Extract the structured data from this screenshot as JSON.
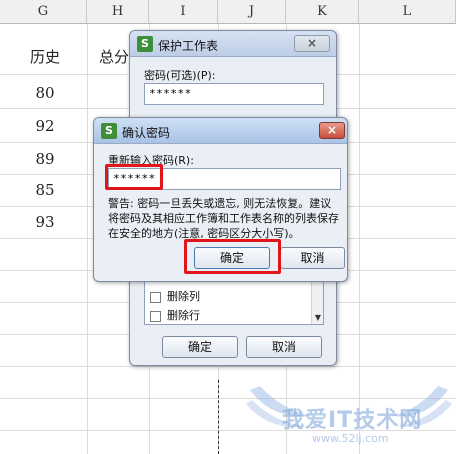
{
  "spreadsheet": {
    "columns": [
      "G",
      "H",
      "I",
      "J",
      "K",
      "L"
    ],
    "header_g": "历史",
    "header_h": "总分",
    "history_values": [
      "80",
      "92",
      "89",
      "85",
      "93"
    ]
  },
  "protect_sheet_dialog": {
    "title": "保护工作表",
    "password_label": "密码(可选)(P):",
    "password_value": "******",
    "options": [
      "删除列",
      "删除行"
    ],
    "ok_label": "确定",
    "cancel_label": "取消",
    "close_label": "×"
  },
  "confirm_password_dialog": {
    "title": "确认密码",
    "reenter_label": "重新输入密码(R):",
    "password_value": "******",
    "warning_line1": "警告: 密码一旦丢失或遗忘, 则无法恢复。建议",
    "warning_line2": "将密码及其相应工作簿和工作表名称的列表保存",
    "warning_line3": "在安全的地方(注意, 密码区分大小写)。",
    "ok_label": "确定",
    "cancel_label": "取消",
    "close_label": "×"
  },
  "watermark": {
    "text": "我爱IT技术网",
    "url": "www.52ij.com"
  },
  "colors": {
    "highlight": "#e0161b",
    "dialog_bg": "#e9eef5",
    "app_icon": "#3f8f3a"
  },
  "icons": {
    "app_icon": "wps-s-icon",
    "checkbox": "checkbox-icon",
    "scroll_down": "scroll-down-arrow-icon"
  }
}
